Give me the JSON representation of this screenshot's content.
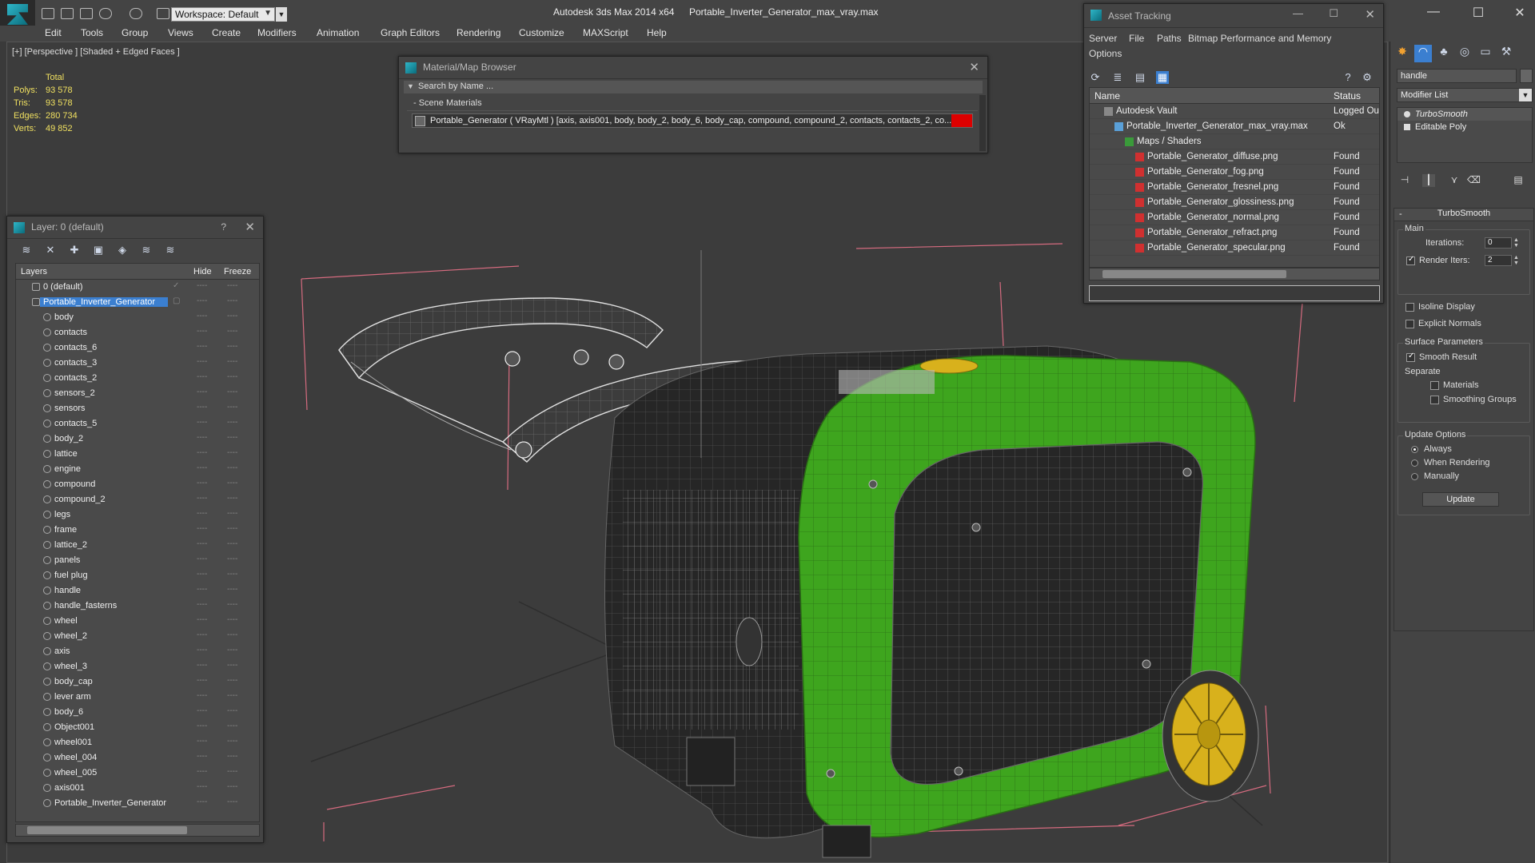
{
  "title_bar": {
    "app_title": "Autodesk 3ds Max  2014 x64",
    "file_title": "Portable_Inverter_Generator_max_vray.max",
    "workspace": "Workspace: Default"
  },
  "menu": [
    "Edit",
    "Tools",
    "Group",
    "Views",
    "Create",
    "Modifiers",
    "Animation",
    "Graph Editors",
    "Rendering",
    "Customize",
    "MAXScript",
    "Help"
  ],
  "viewport": {
    "label": "[+] [Perspective ] [Shaded + Edged Faces ]",
    "stats": {
      "header": "Total",
      "rows": [
        {
          "key": "Polys:",
          "value": "93 578"
        },
        {
          "key": "Tris:",
          "value": "93 578"
        },
        {
          "key": "Edges:",
          "value": "280 734"
        },
        {
          "key": "Verts:",
          "value": "49 852"
        }
      ]
    }
  },
  "material_browser": {
    "title": "Material/Map Browser",
    "search_placeholder": "Search by Name ...",
    "group": "- Scene Materials",
    "material": "Portable_Generator  ( VRayMtl ) [axis, axis001, body, body_2, body_6, body_cap, compound, compound_2, contacts, contacts_2, co..."
  },
  "layer_panel": {
    "title": "Layer: 0 (default)",
    "help": "?",
    "columns": {
      "layers": "Layers",
      "hide": "Hide",
      "freeze": "Freeze"
    },
    "top_layers": [
      {
        "name": "0 (default)",
        "checked": true
      },
      {
        "name": "Portable_Inverter_Generator",
        "selected": true
      }
    ],
    "objects": [
      "body",
      "contacts",
      "contacts_6",
      "contacts_3",
      "contacts_2",
      "sensors_2",
      "sensors",
      "contacts_5",
      "body_2",
      "lattice",
      "engine",
      "compound",
      "compound_2",
      "legs",
      "frame",
      "lattice_2",
      "panels",
      "fuel plug",
      "handle",
      "handle_fasterns",
      "wheel",
      "wheel_2",
      "axis",
      "wheel_3",
      "body_cap",
      "lever arm",
      "body_6",
      "Object001",
      "wheel001",
      "wheel_004",
      "wheel_005",
      "axis001",
      "Portable_Inverter_Generator"
    ]
  },
  "asset_tracking": {
    "title": "Asset Tracking",
    "menu": [
      "Server",
      "File",
      "Paths",
      "Bitmap Performance and Memory",
      "Options"
    ],
    "columns": {
      "name": "Name",
      "status": "Status"
    },
    "rows": [
      {
        "name": "Autodesk Vault",
        "status": "Logged Ou",
        "indent": 0
      },
      {
        "name": "Portable_Inverter_Generator_max_vray.max",
        "status": "Ok",
        "indent": 1
      },
      {
        "name": "Maps / Shaders",
        "status": "",
        "indent": 2
      },
      {
        "name": "Portable_Generator_diffuse.png",
        "status": "Found",
        "indent": 3
      },
      {
        "name": "Portable_Generator_fog.png",
        "status": "Found",
        "indent": 3
      },
      {
        "name": "Portable_Generator_fresnel.png",
        "status": "Found",
        "indent": 3
      },
      {
        "name": "Portable_Generator_glossiness.png",
        "status": "Found",
        "indent": 3
      },
      {
        "name": "Portable_Generator_normal.png",
        "status": "Found",
        "indent": 3
      },
      {
        "name": "Portable_Generator_refract.png",
        "status": "Found",
        "indent": 3
      },
      {
        "name": "Portable_Generator_specular.png",
        "status": "Found",
        "indent": 3
      }
    ]
  },
  "command_panel": {
    "object_name": "handle",
    "modifier_list": "Modifier List",
    "stack": [
      "TurboSmooth",
      "Editable Poly"
    ],
    "turbosmooth": {
      "title": "TurboSmooth",
      "main": "Main",
      "iterations_label": "Iterations:",
      "iterations": "0",
      "render_iters_label": "Render Iters:",
      "render_iters": "2",
      "isoline": "Isoline Display",
      "explicit_normals": "Explicit Normals",
      "surface_params": "Surface Parameters",
      "smooth_result": "Smooth Result",
      "separate": "Separate",
      "materials": "Materials",
      "smoothing_groups": "Smoothing Groups",
      "update_options": "Update Options",
      "always": "Always",
      "when_rendering": "When Rendering",
      "manually": "Manually",
      "update": "Update"
    }
  },
  "colors": {
    "body_green": "#3ea51e",
    "body_dark": "#2a2a2a",
    "wheel_yellow": "#d8b11c",
    "selection_blue": "#3b7fd0"
  }
}
